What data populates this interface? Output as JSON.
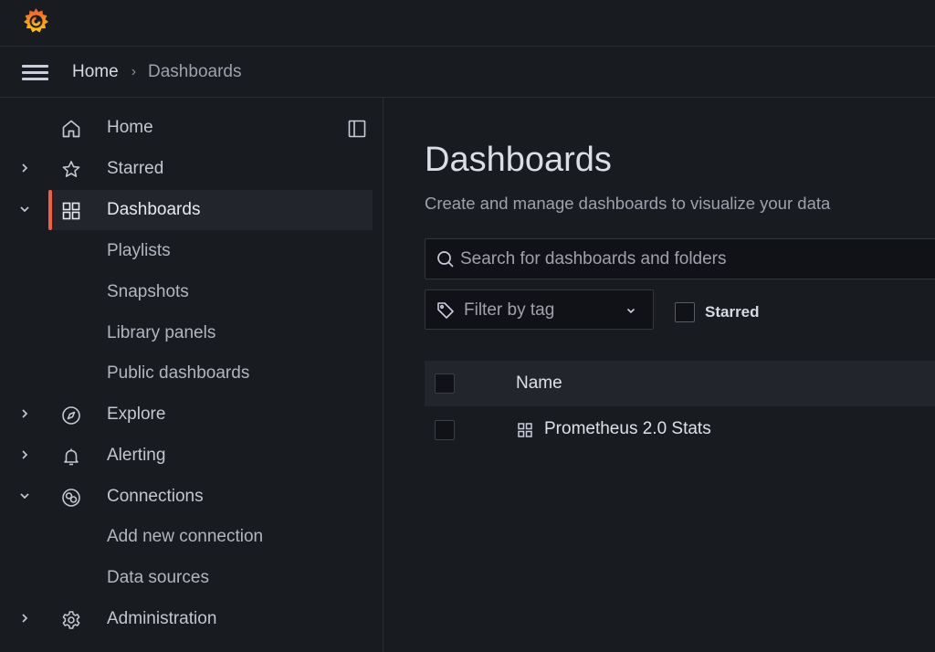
{
  "breadcrumb": {
    "home": "Home",
    "separator": "›",
    "current": "Dashboards"
  },
  "sidebar": {
    "items": [
      {
        "label": "Home",
        "icon": "home-icon",
        "expandable": false
      },
      {
        "label": "Starred",
        "icon": "star-icon",
        "expandable": true,
        "expanded": false
      },
      {
        "label": "Dashboards",
        "icon": "dashboards-icon",
        "expandable": true,
        "expanded": true,
        "active": true
      },
      {
        "label": "Explore",
        "icon": "compass-icon",
        "expandable": true,
        "expanded": false
      },
      {
        "label": "Alerting",
        "icon": "bell-icon",
        "expandable": true,
        "expanded": false
      },
      {
        "label": "Connections",
        "icon": "connections-icon",
        "expandable": true,
        "expanded": true
      },
      {
        "label": "Administration",
        "icon": "gear-icon",
        "expandable": true,
        "expanded": false
      }
    ],
    "dashboards_children": [
      "Playlists",
      "Snapshots",
      "Library panels",
      "Public dashboards"
    ],
    "connections_children": [
      "Add new connection",
      "Data sources"
    ]
  },
  "main": {
    "title": "Dashboards",
    "subtitle": "Create and manage dashboards to visualize your data",
    "search": {
      "placeholder": "Search for dashboards and folders",
      "value": ""
    },
    "tag_filter": {
      "placeholder": "Filter by tag"
    },
    "starred": {
      "label": "Starred",
      "checked": false
    },
    "table": {
      "columns": [
        "Name"
      ],
      "rows": [
        {
          "name": "Prometheus 2.0 Stats",
          "icon": "dashboards-icon"
        }
      ]
    }
  },
  "colors": {
    "accent": "#f55f3e",
    "background": "#181b1f",
    "panel": "#22252b",
    "logo_orange": "#f5821f"
  }
}
